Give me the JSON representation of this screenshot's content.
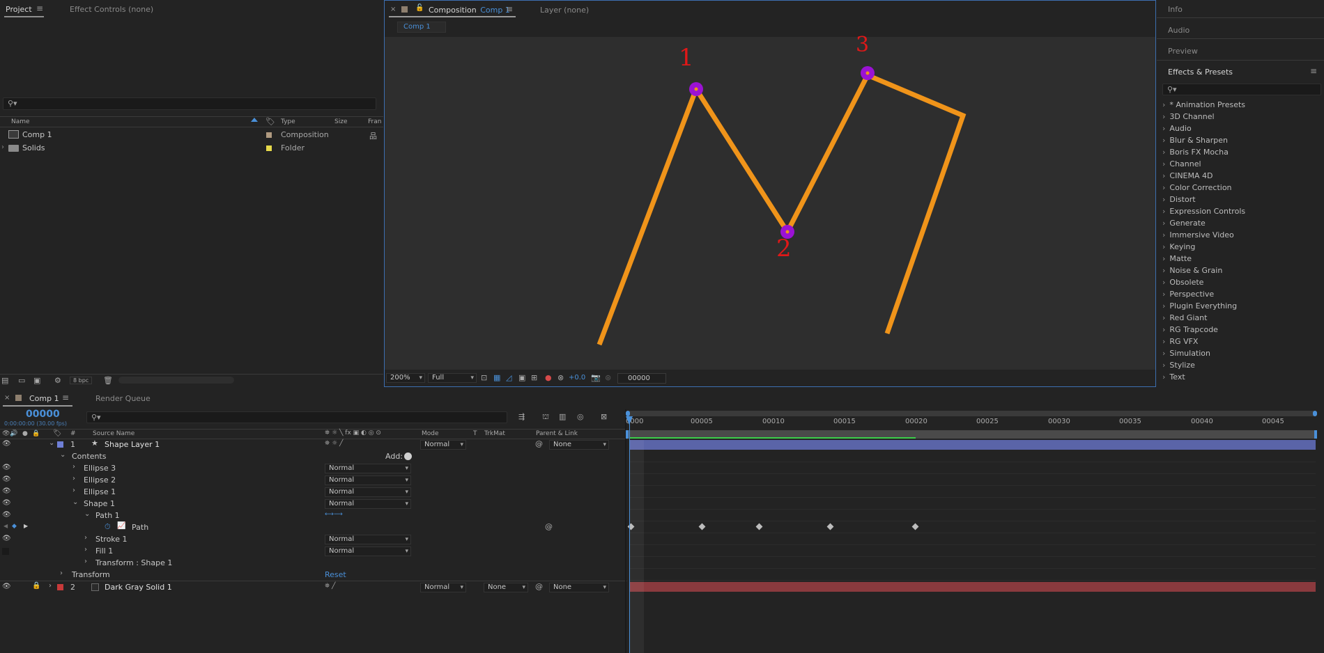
{
  "project_panel": {
    "tab_project": "Project",
    "tab_effect_controls": "Effect Controls (none)",
    "columns": {
      "name": "Name",
      "type": "Type",
      "size": "Size",
      "frame": "Fran"
    },
    "items": [
      {
        "name": "Comp 1",
        "type": "Composition",
        "color": "#b09a80"
      },
      {
        "name": "Solids",
        "type": "Folder",
        "color": "#e6d94a"
      }
    ],
    "bpc": "8 bpc"
  },
  "composition_panel": {
    "tab_label": "Composition",
    "tab_comp": "Comp 1",
    "tab_layer": "Layer (none)",
    "subtab": "Comp 1",
    "zoom": "200%",
    "resolution": "Full",
    "exposure": "+0.0",
    "timecode": "00000",
    "annotations": [
      "1",
      "2",
      "3"
    ]
  },
  "right_panel": {
    "info": "Info",
    "audio": "Audio",
    "preview": "Preview",
    "effects_presets": "Effects & Presets",
    "items": [
      "* Animation Presets",
      "3D Channel",
      "Audio",
      "Blur & Sharpen",
      "Boris FX Mocha",
      "Channel",
      "CINEMA 4D",
      "Color Correction",
      "Distort",
      "Expression Controls",
      "Generate",
      "Immersive Video",
      "Keying",
      "Matte",
      "Noise & Grain",
      "Obsolete",
      "Perspective",
      "Plugin Everything",
      "Red Giant",
      "RG Trapcode",
      "RG VFX",
      "Simulation",
      "Stylize",
      "Text"
    ]
  },
  "timeline": {
    "tab_comp": "Comp 1",
    "tab_render": "Render Queue",
    "timecode": "00000",
    "timecode_sub": "0:00:00:00 (30.00 fps)",
    "headers": {
      "num": "#",
      "source": "Source Name",
      "mode": "Mode",
      "t": "T",
      "trkmat": "TrkMat",
      "parent": "Parent & Link"
    },
    "ruler": [
      "0000",
      "00005",
      "00010",
      "00015",
      "00020",
      "00025",
      "00030",
      "00035",
      "00040",
      "00045"
    ],
    "layer1": {
      "num": "1",
      "name": "Shape Layer 1",
      "mode": "Normal",
      "parent": "None",
      "color": "#6f7fd6"
    },
    "contents": "Contents",
    "add": "Add:",
    "ellipse3": "Ellipse 3",
    "ellipse2": "Ellipse 2",
    "ellipse1": "Ellipse 1",
    "shape1": "Shape 1",
    "path1": "Path 1",
    "path": "Path",
    "stroke1": "Stroke 1",
    "fill1": "Fill 1",
    "transform_shape": "Transform : Shape 1",
    "transform": "Transform",
    "reset": "Reset",
    "mode_normal": "Normal",
    "layer2": {
      "num": "2",
      "name": "Dark Gray Solid 1",
      "mode": "Normal",
      "trkmat": "None",
      "parent": "None",
      "color": "#c83a3a"
    }
  }
}
